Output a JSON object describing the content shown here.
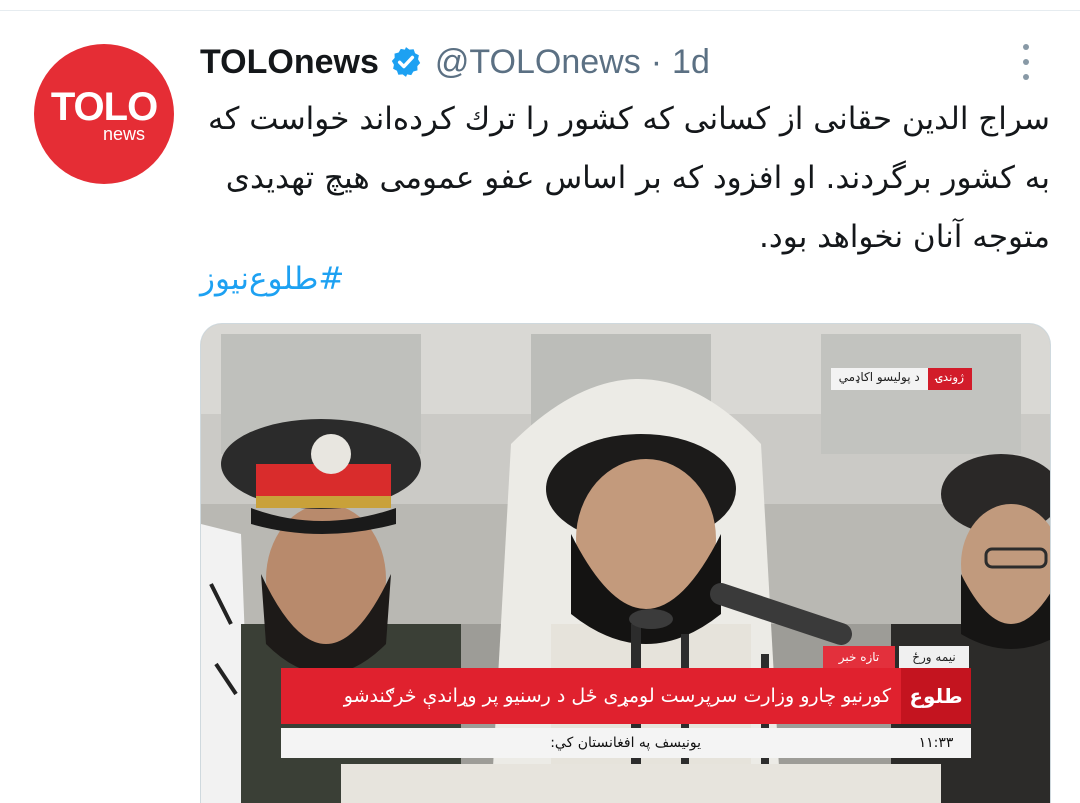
{
  "tweet": {
    "display_name": "TOLOnews",
    "handle": "@TOLOnews",
    "separator": "·",
    "age": "1d",
    "text": "سراج الدين حقانى از كسانى كه كشور را ترك كرده‌اند خواست كه به كشور برگردند. او افزود كه بر اساس عفو عمومى هيچ تهديدى متوجه آنان نخواهد بود.",
    "hashtag": "#طلوع‌نيوز"
  },
  "avatar": {
    "logo_main": "TOLO",
    "logo_sub": "news"
  },
  "icons": {
    "verified": "verified-badge-icon",
    "more": "more-options-icon"
  },
  "media": {
    "live_label": "ژوندۍ",
    "location_label": "د پولیسو اکاډمي",
    "ticker_label_red": "تازه خبر",
    "ticker_label_white": "نیمه ورځ",
    "headline": "كورنيو چارو وزارت سرپرست لومړى ځل د رسنيو پر وړاندې څرګندشو",
    "sub_headline": "يونيسف په افغانستان كي:",
    "channel_logo": "طلوع",
    "clock": "١١:٣٣"
  },
  "colors": {
    "brand_red": "#e52d35",
    "link_blue": "#1da1f2",
    "verified_blue": "#1da1f2"
  }
}
